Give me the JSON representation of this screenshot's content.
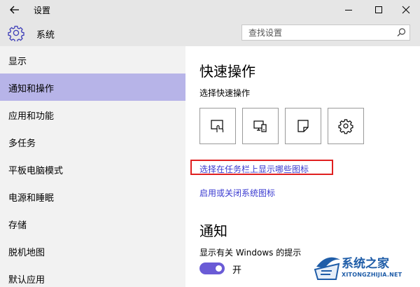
{
  "window": {
    "title": "设置",
    "controls": {
      "minimize": "minimize-icon",
      "maximize": "maximize-icon",
      "close": "close-icon"
    }
  },
  "header": {
    "title": "系统",
    "icon": "gear-icon",
    "search": {
      "placeholder": "查找设置",
      "value": ""
    }
  },
  "sidebar": {
    "items": [
      {
        "label": "显示",
        "active": false
      },
      {
        "label": "通知和操作",
        "active": true
      },
      {
        "label": "应用和功能",
        "active": false
      },
      {
        "label": "多任务",
        "active": false
      },
      {
        "label": "平板电脑模式",
        "active": false
      },
      {
        "label": "电源和睡眠",
        "active": false
      },
      {
        "label": "存储",
        "active": false
      },
      {
        "label": "脱机地图",
        "active": false
      },
      {
        "label": "默认应用",
        "active": false
      }
    ]
  },
  "main": {
    "quick_actions": {
      "heading": "快速操作",
      "subheading": "选择快速操作",
      "tiles": [
        {
          "icon": "tablet-mode-icon"
        },
        {
          "icon": "connect-display-icon"
        },
        {
          "icon": "note-icon"
        },
        {
          "icon": "settings-gear-icon"
        }
      ]
    },
    "links": {
      "taskbar_icons": "选择在任务栏上显示哪些图标",
      "system_icons": "启用或关闭系统图标"
    },
    "notifications": {
      "heading": "通知",
      "windows_tips_label": "显示有关 Windows 的提示",
      "toggle_state": "开"
    }
  },
  "watermark": {
    "name": "系统之家",
    "url": "XITONGZHIJIA.NET"
  },
  "colors": {
    "title_bar": "#e6e6e6",
    "sidebar": "#f2f2f2",
    "sidebar_active": "#b7b4e8",
    "link": "#3a3ad0",
    "toggle_on": "#6a5bd6",
    "highlight_box": "#e02020"
  }
}
